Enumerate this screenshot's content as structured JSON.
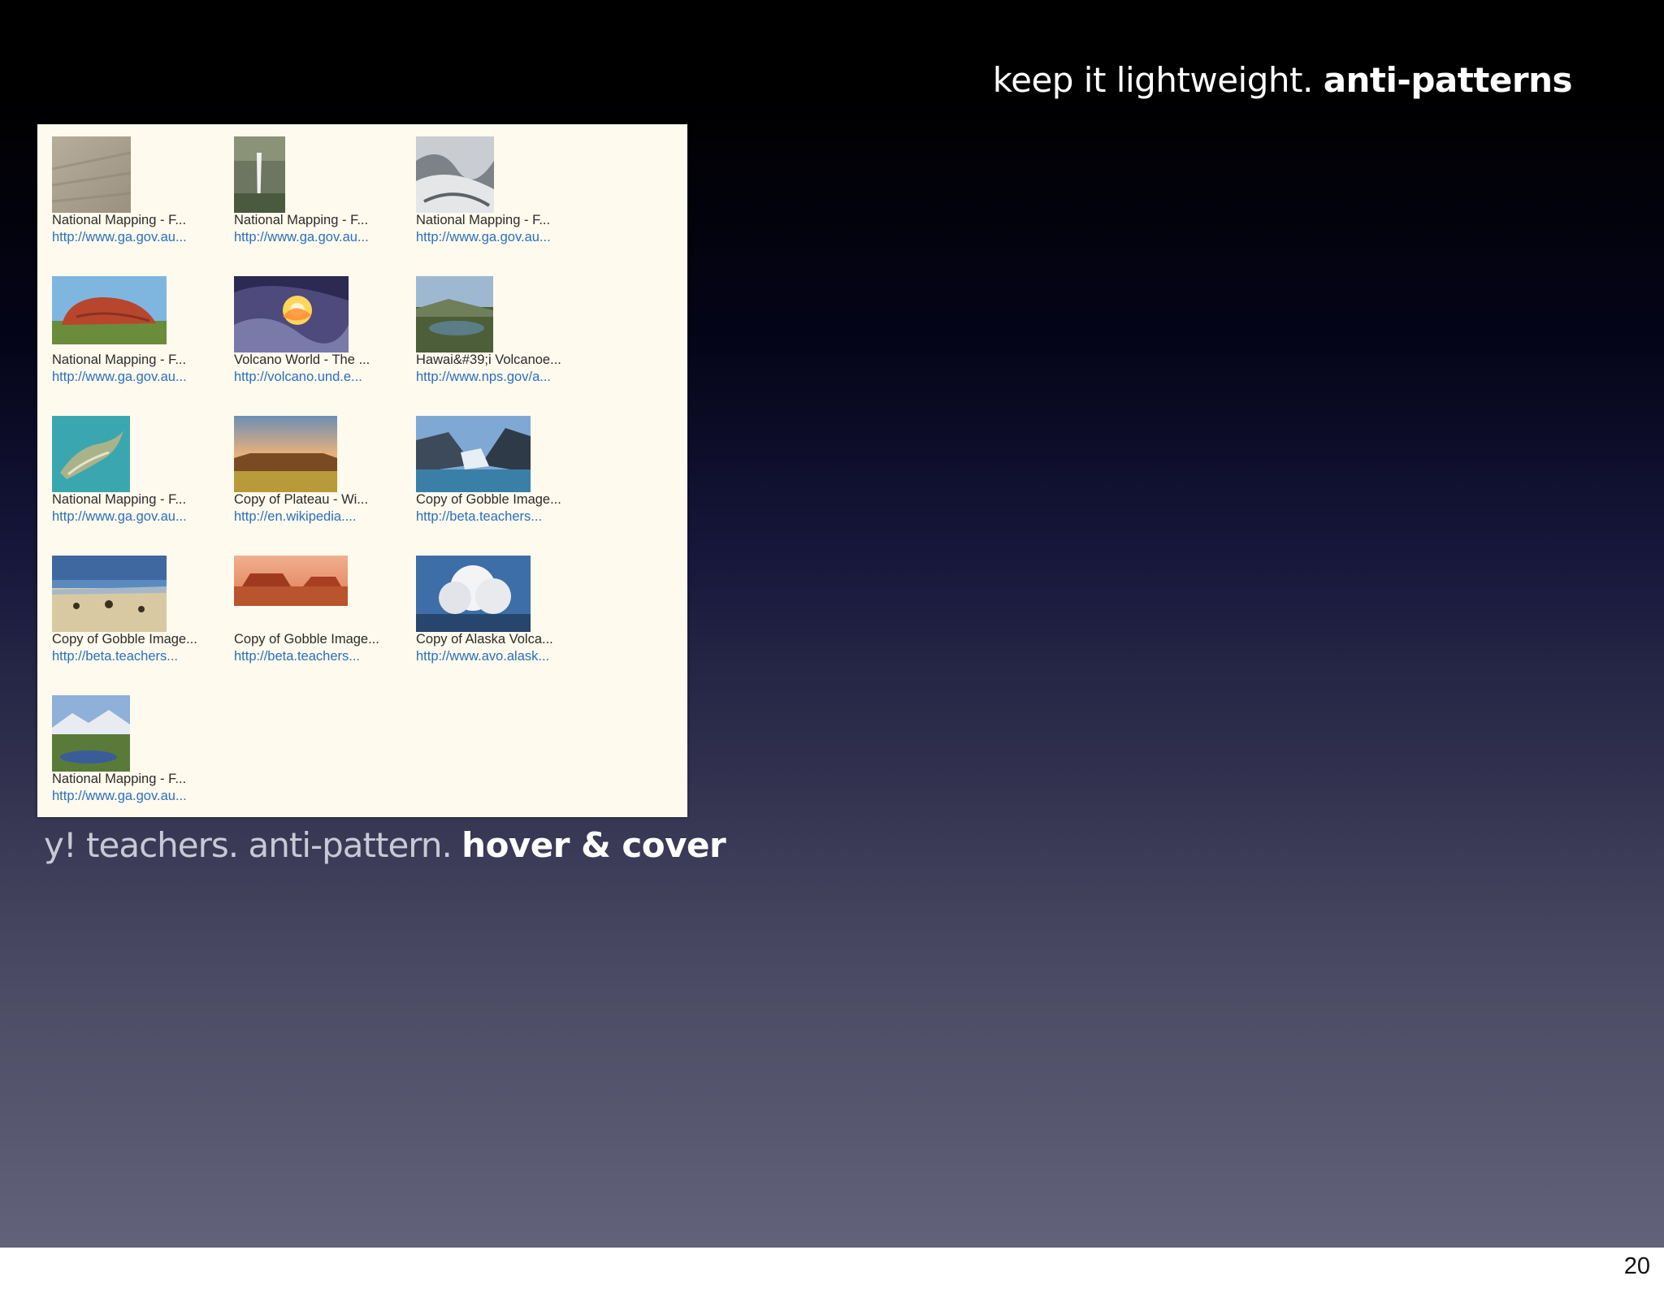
{
  "slide": {
    "title_light": "keep it lightweight.",
    "title_bold": "anti-patterns",
    "caption_light": "y! teachers. anti-pattern.",
    "caption_bold": "hover & cover",
    "page_number": "20"
  },
  "results": [
    {
      "title": "National Mapping - F...",
      "url": "http://www.ga.gov.au...",
      "thumb": "desert-dunes"
    },
    {
      "title": "National Mapping - F...",
      "url": "http://www.ga.gov.au...",
      "thumb": "waterfall"
    },
    {
      "title": "National Mapping - F...",
      "url": "http://www.ga.gov.au...",
      "thumb": "aerial-mountains"
    },
    {
      "title": "National Mapping - F...",
      "url": "http://www.ga.gov.au...",
      "thumb": "uluru"
    },
    {
      "title": "Volcano World - The ...",
      "url": "http://volcano.und.e...",
      "thumb": "lava-flow"
    },
    {
      "title": "Hawai&#39;i Volcanoe...",
      "url": "http://www.nps.gov/a...",
      "thumb": "volcano-lake"
    },
    {
      "title": "National Mapping - F...",
      "url": "http://www.ga.gov.au...",
      "thumb": "island-aerial"
    },
    {
      "title": "Copy of Plateau - Wi...",
      "url": "http://en.wikipedia....",
      "thumb": "plateau"
    },
    {
      "title": "Copy of Gobble Image...",
      "url": "http://beta.teachers...",
      "thumb": "glacier"
    },
    {
      "title": "Copy of Gobble Image...",
      "url": "http://beta.teachers...",
      "thumb": "beach-plain"
    },
    {
      "title": "Copy of Gobble Image...",
      "url": "http://beta.teachers...",
      "thumb": "mesa"
    },
    {
      "title": "Copy of Alaska Volca...",
      "url": "http://www.avo.alask...",
      "thumb": "eruption-cloud"
    },
    {
      "title": "National Mapping - F...",
      "url": "http://www.ga.gov.au...",
      "thumb": "mountain-lake"
    }
  ]
}
